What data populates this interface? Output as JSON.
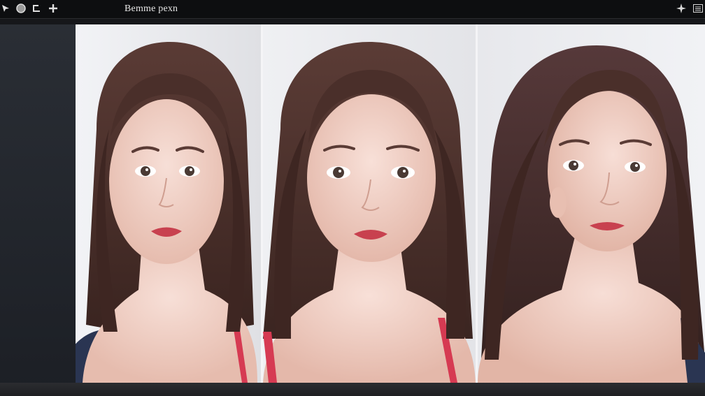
{
  "window": {
    "title": "Bemme pexn"
  },
  "toolbar": {
    "left_icons": [
      "pointer-icon",
      "circle-icon",
      "crop-icon",
      "add-icon"
    ],
    "right_icons": [
      "sparkle-icon",
      "menu-icon"
    ]
  },
  "panels": [
    {
      "name": "portrait-1"
    },
    {
      "name": "portrait-2"
    },
    {
      "name": "portrait-3"
    }
  ],
  "colors": {
    "topbar": "#0d0e10",
    "hair": "#4a2f2a",
    "skin": "#f0d2c8",
    "lips": "#c8414f",
    "strap": "#d63a52",
    "cardigan": "#2a3552"
  }
}
